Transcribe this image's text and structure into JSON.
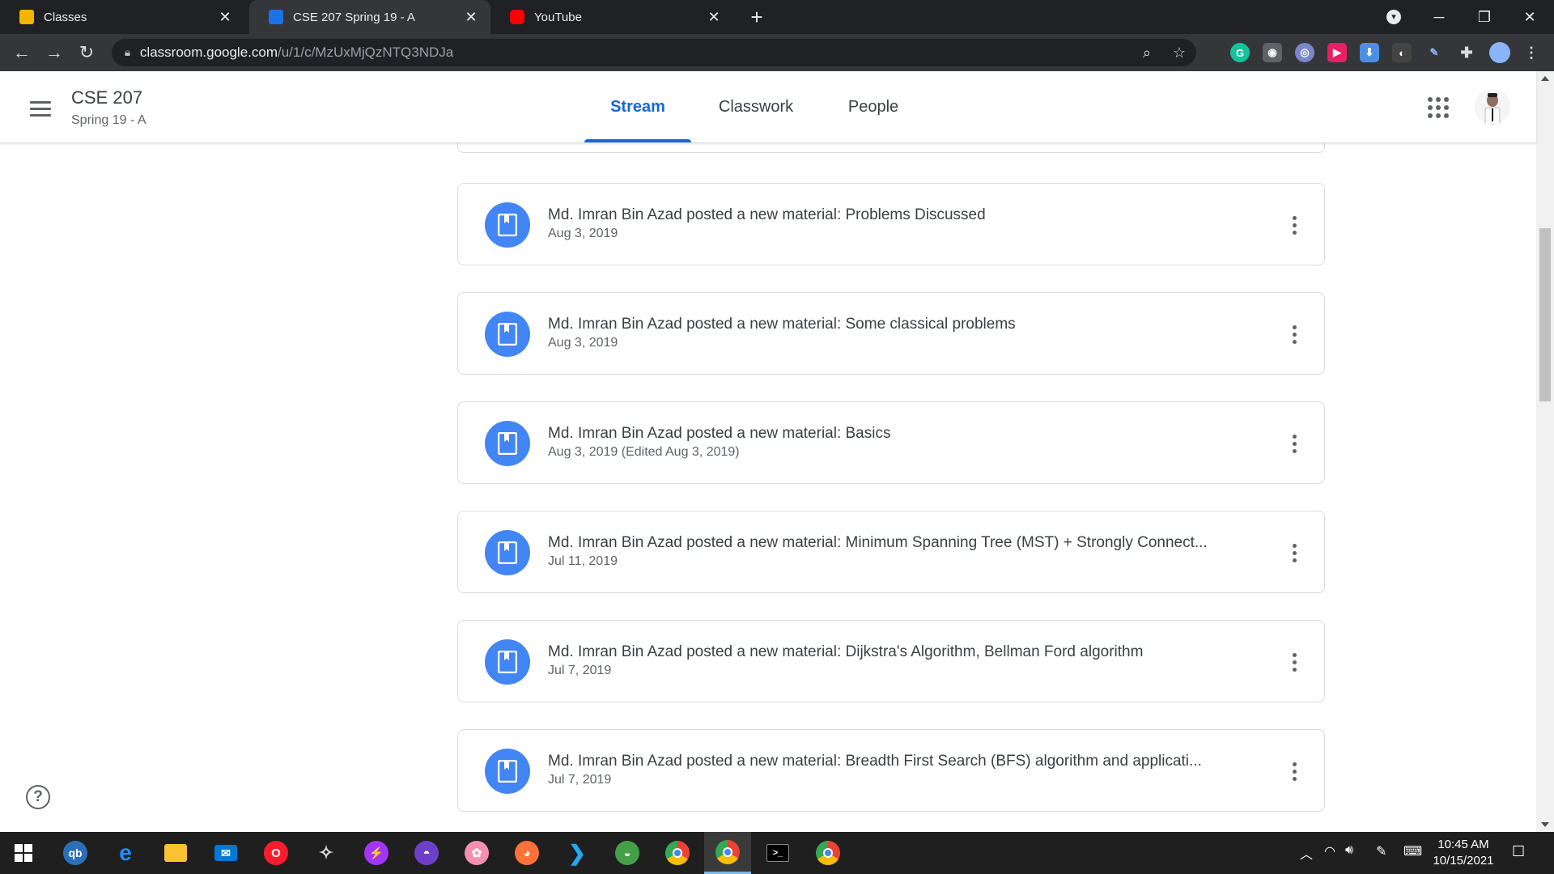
{
  "browser": {
    "tabs": [
      {
        "title": "Classes",
        "favicon_color": "#f4b400"
      },
      {
        "title": "CSE 207 Spring 19 - A",
        "favicon_color": "#1a73e8"
      },
      {
        "title": "YouTube",
        "favicon_color": "#ff0000"
      }
    ],
    "address": {
      "host": "classroom.google.com",
      "path": "/u/1/c/MzUxMjQzNTQ3NDJa"
    }
  },
  "classroom": {
    "title": "CSE 207",
    "section": "Spring 19 - A",
    "tabs": [
      "Stream",
      "Classwork",
      "People"
    ],
    "active_tab": "Stream",
    "accent": "#1967d2"
  },
  "stream": {
    "posts": [
      {
        "text": "Md. Imran Bin Azad posted a new material: Problems Discussed",
        "date": "Aug 3, 2019"
      },
      {
        "text": "Md. Imran Bin Azad posted a new material: Some classical problems",
        "date": "Aug 3, 2019"
      },
      {
        "text": "Md. Imran Bin Azad posted a new material: Basics",
        "date": "Aug 3, 2019 (Edited Aug 3, 2019)"
      },
      {
        "text": "Md. Imran Bin Azad posted a new material: Minimum Spanning Tree (MST) + Strongly Connect...",
        "date": "Jul 11, 2019"
      },
      {
        "text": "Md. Imran Bin Azad posted a new material: Dijkstra's Algorithm, Bellman Ford algorithm",
        "date": "Jul 7, 2019"
      },
      {
        "text": "Md. Imran Bin Azad posted a new material: Breadth First Search (BFS) algorithm and applicati...",
        "date": "Jul 7, 2019"
      }
    ],
    "material_icon_color": "#4285f4"
  },
  "help": {
    "label": "?"
  },
  "taskbar": {
    "clock": {
      "time": "10:45 AM",
      "date": "10/15/2021"
    }
  }
}
